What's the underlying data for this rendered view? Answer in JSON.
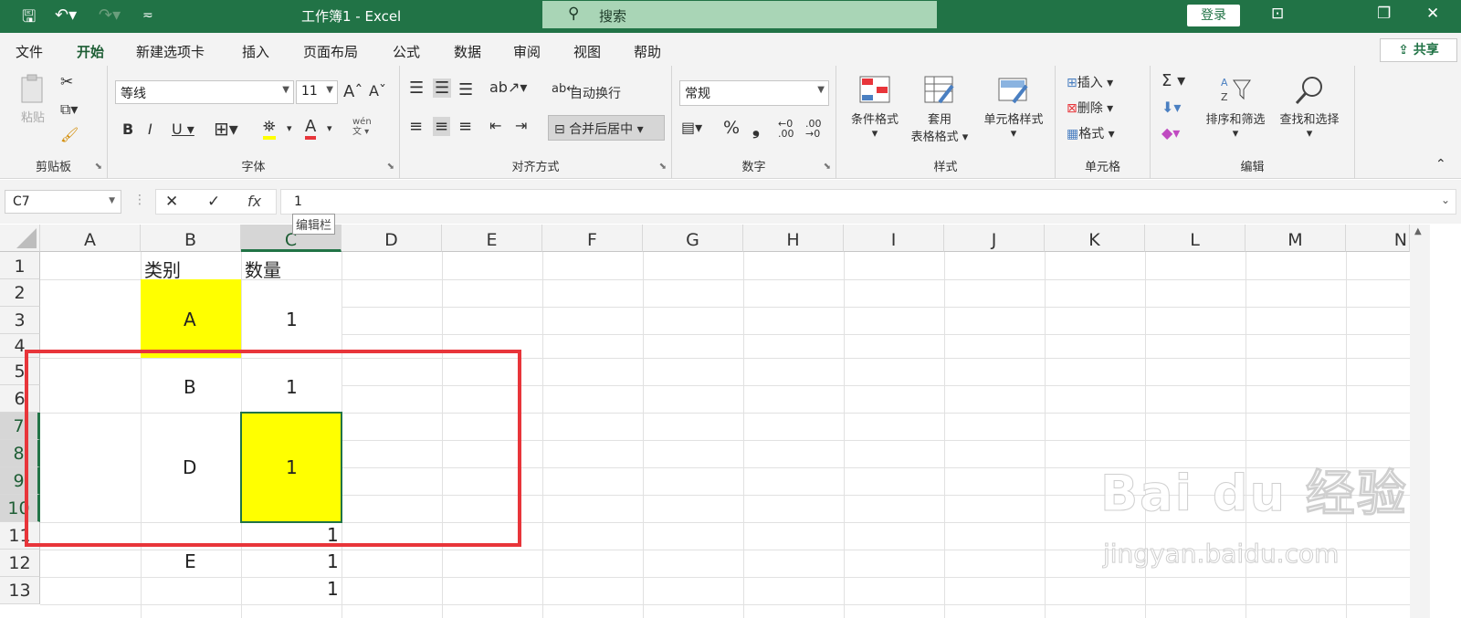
{
  "titlebar": {
    "title": "工作簿1  -  Excel",
    "search_placeholder": "搜索",
    "login": "登录"
  },
  "tabs": [
    "文件",
    "开始",
    "新建选项卡",
    "插入",
    "页面布局",
    "公式",
    "数据",
    "审阅",
    "视图",
    "帮助"
  ],
  "share_label": "共享",
  "ribbon": {
    "clipboard": {
      "label": "剪贴板",
      "paste": "粘贴"
    },
    "font": {
      "label": "字体",
      "font_name": "等线",
      "font_size": "11",
      "wen": "wén\n文"
    },
    "align": {
      "label": "对齐方式",
      "wrap": "自动换行",
      "merge": "合并后居中"
    },
    "number": {
      "label": "数字",
      "format": "常规"
    },
    "styles": {
      "label": "样式",
      "conditional": "条件格式",
      "table_line1": "套用",
      "table_line2": "表格格式",
      "cell_styles": "单元格样式"
    },
    "cells": {
      "label": "单元格",
      "insert": "插入",
      "delete": "删除",
      "format": "格式"
    },
    "editing": {
      "label": "编辑",
      "sort": "排序和筛选",
      "find": "查找和选择"
    }
  },
  "formula": {
    "namebox": "C7",
    "value": "1",
    "tooltip": "编辑栏"
  },
  "columns": [
    "A",
    "B",
    "C",
    "D",
    "E",
    "F",
    "G",
    "H",
    "I",
    "J",
    "K",
    "L",
    "M",
    "N"
  ],
  "rows": [
    "1",
    "2",
    "3",
    "4",
    "5",
    "6",
    "7",
    "8",
    "9",
    "10",
    "11",
    "12",
    "13"
  ],
  "cells": {
    "b1": "类别",
    "c1": "数量",
    "b3": "A",
    "c3": "1",
    "b5": "B",
    "c5": "1",
    "b8": "D",
    "c8": "1",
    "c11": "1",
    "b12": "E",
    "c12": "1",
    "c13": "1"
  },
  "watermark": {
    "brand": "Bai du 经验",
    "url": "jingyan.baidu.com"
  },
  "colors": {
    "excel_green": "#217346",
    "highlight_yellow": "#ffff00",
    "annotation_red": "#e8353a"
  }
}
